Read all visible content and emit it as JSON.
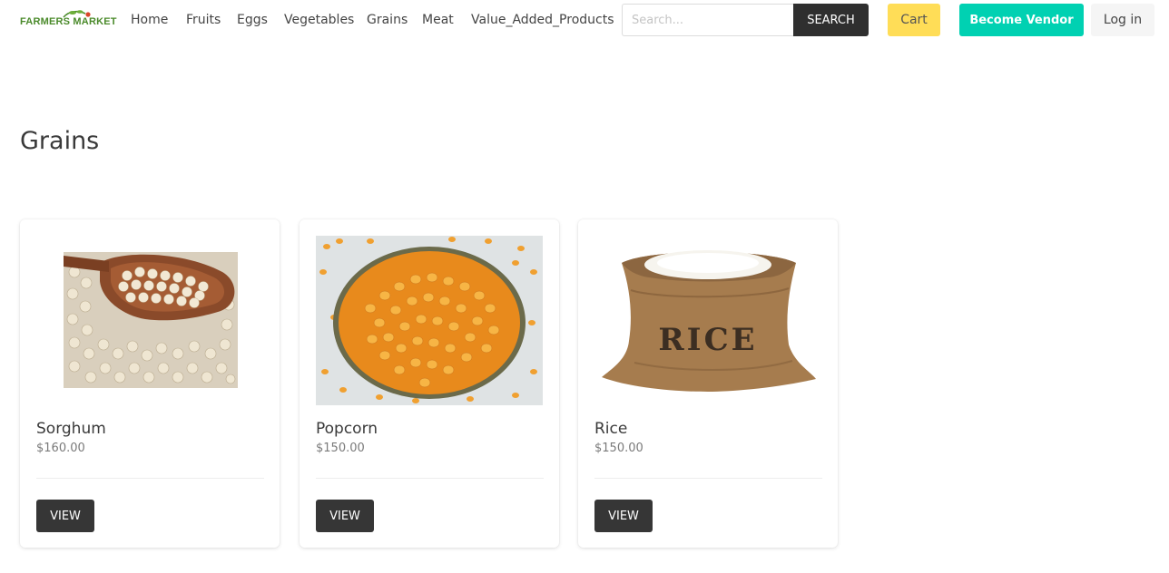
{
  "brand": {
    "name": "FARMERS MARKET"
  },
  "nav": {
    "links": [
      "Home",
      "Fruits",
      "Eggs",
      "Vegetables",
      "Grains",
      "Meat",
      "Value_Added_Products"
    ]
  },
  "search": {
    "placeholder": "Search...",
    "value": "",
    "button_label": "SEARCH"
  },
  "actions": {
    "cart": "Cart",
    "become_vendor": "Become Vendor",
    "login": "Log in"
  },
  "colors": {
    "vendor_accent": "#00d1b2",
    "cart_accent": "#ffdd57",
    "dark_button": "#363636",
    "logo_green": "#4a8a2a"
  },
  "page": {
    "title": "Grains"
  },
  "products": [
    {
      "name": "Sorghum",
      "price": "$160.00",
      "button": "VIEW",
      "image_icon": "sorghum-image"
    },
    {
      "name": "Popcorn",
      "price": "$150.00",
      "button": "VIEW",
      "image_icon": "popcorn-image"
    },
    {
      "name": "Rice",
      "price": "$150.00",
      "button": "VIEW",
      "image_icon": "rice-image"
    }
  ],
  "rice_bag_label": "RICE"
}
